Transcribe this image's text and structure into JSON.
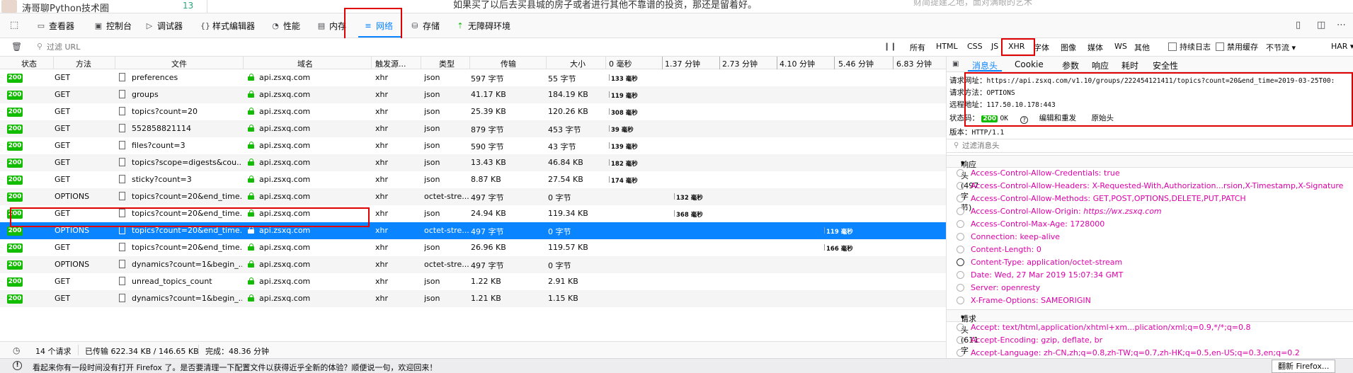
{
  "page_strip": {
    "author": "涛哥聊Python技术圈",
    "count": "13",
    "article_text": "如果买了以后去买县城的房子或者进行其他不靠谱的投资，那还是留着好。",
    "side_text": "财简提建之地，面对满眼的艺术"
  },
  "devtools_tabs": [
    {
      "label": "查看器",
      "icon": "inspector-icon"
    },
    {
      "label": "控制台",
      "icon": "console-icon"
    },
    {
      "label": "调试器",
      "icon": "debugger-icon"
    },
    {
      "label": "样式编辑器",
      "icon": "style-editor-icon"
    },
    {
      "label": "性能",
      "icon": "performance-icon"
    },
    {
      "label": "内存",
      "icon": "memory-icon"
    },
    {
      "label": "网络",
      "icon": "network-icon"
    },
    {
      "label": "存储",
      "icon": "storage-icon"
    },
    {
      "label": "无障碍环境",
      "icon": "accessibility-icon"
    }
  ],
  "selected_tab": "网络",
  "filter": {
    "placeholder": "过滤 URL",
    "types": [
      "所有",
      "HTML",
      "CSS",
      "JS",
      "XHR",
      "字体",
      "图像",
      "媒体",
      "WS",
      "其他"
    ],
    "active_type": "XHR",
    "persist_logs": "持续日志",
    "disable_cache": "禁用缓存",
    "throttle": "不节流 ▾",
    "har": "HAR ▾"
  },
  "columns": [
    "状态",
    "方法",
    "文件",
    "域名",
    "触发源...",
    "类型",
    "传输",
    "大小"
  ],
  "waterfall_ticks": [
    "0 毫秒",
    "1.37 分钟",
    "2.73 分钟",
    "4.10 分钟",
    "5.46 分钟",
    "6.83 分钟"
  ],
  "requests": [
    {
      "status": "200",
      "method": "GET",
      "file": "preferences",
      "domain": "api.zsxq.com",
      "cause": "xhr",
      "type": "json",
      "transferred": "597 字节",
      "size": "55 字节",
      "timing": "133 毫秒",
      "wf_pos": 0
    },
    {
      "status": "200",
      "method": "GET",
      "file": "groups",
      "domain": "api.zsxq.com",
      "cause": "xhr",
      "type": "json",
      "transferred": "41.17 KB",
      "size": "184.19 KB",
      "timing": "119 毫秒",
      "wf_pos": 0
    },
    {
      "status": "200",
      "method": "GET",
      "file": "topics?count=20",
      "domain": "api.zsxq.com",
      "cause": "xhr",
      "type": "json",
      "transferred": "25.39 KB",
      "size": "120.26 KB",
      "timing": "308 毫秒",
      "wf_pos": 0
    },
    {
      "status": "200",
      "method": "GET",
      "file": "552858821114",
      "domain": "api.zsxq.com",
      "cause": "xhr",
      "type": "json",
      "transferred": "879 字节",
      "size": "453 字节",
      "timing": "39 毫秒",
      "wf_pos": 0
    },
    {
      "status": "200",
      "method": "GET",
      "file": "files?count=3",
      "domain": "api.zsxq.com",
      "cause": "xhr",
      "type": "json",
      "transferred": "590 字节",
      "size": "43 字节",
      "timing": "139 毫秒",
      "wf_pos": 0
    },
    {
      "status": "200",
      "method": "GET",
      "file": "topics?scope=digests&cou...",
      "domain": "api.zsxq.com",
      "cause": "xhr",
      "type": "json",
      "transferred": "13.43 KB",
      "size": "46.84 KB",
      "timing": "182 毫秒",
      "wf_pos": 0
    },
    {
      "status": "200",
      "method": "GET",
      "file": "sticky?count=3",
      "domain": "api.zsxq.com",
      "cause": "xhr",
      "type": "json",
      "transferred": "8.87 KB",
      "size": "27.54 KB",
      "timing": "174 毫秒",
      "wf_pos": 0
    },
    {
      "status": "200",
      "method": "OPTIONS",
      "file": "topics?count=20&end_time...",
      "domain": "api.zsxq.com",
      "cause": "xhr",
      "type": "octet-stre...",
      "transferred": "497 字节",
      "size": "0 字节",
      "timing": "132 毫秒",
      "wf_pos": 0.2
    },
    {
      "status": "200",
      "method": "GET",
      "file": "topics?count=20&end_time...",
      "domain": "api.zsxq.com",
      "cause": "xhr",
      "type": "json",
      "transferred": "24.94 KB",
      "size": "119.34 KB",
      "timing": "368 毫秒",
      "wf_pos": 0.2
    },
    {
      "status": "200",
      "method": "OPTIONS",
      "file": "topics?count=20&end_time...",
      "domain": "api.zsxq.com",
      "cause": "xhr",
      "type": "octet-stre...",
      "transferred": "497 字节",
      "size": "0 字节",
      "timing": "119 毫秒",
      "wf_pos": 0.66,
      "selected": true
    },
    {
      "status": "200",
      "method": "GET",
      "file": "topics?count=20&end_time...",
      "domain": "api.zsxq.com",
      "cause": "xhr",
      "type": "json",
      "transferred": "26.96 KB",
      "size": "119.57 KB",
      "timing": "166 毫秒",
      "wf_pos": 0.66
    },
    {
      "status": "200",
      "method": "OPTIONS",
      "file": "dynamics?count=1&begin_...",
      "domain": "api.zsxq.com",
      "cause": "xhr",
      "type": "octet-stre...",
      "transferred": "497 字节",
      "size": "0 字节",
      "timing": "",
      "wf_pos": 0
    },
    {
      "status": "200",
      "method": "GET",
      "file": "unread_topics_count",
      "domain": "api.zsxq.com",
      "cause": "xhr",
      "type": "json",
      "transferred": "1.22 KB",
      "size": "2.91 KB",
      "timing": "",
      "wf_pos": 0
    },
    {
      "status": "200",
      "method": "GET",
      "file": "dynamics?count=1&begin_...",
      "domain": "api.zsxq.com",
      "cause": "xhr",
      "type": "json",
      "transferred": "1.21 KB",
      "size": "1.15 KB",
      "timing": "",
      "wf_pos": 0
    }
  ],
  "summary": {
    "requests": "14 个请求",
    "transferred": "已传输 622.34 KB / 146.65 KB",
    "finish": "完成：48.36 分钟"
  },
  "details": {
    "tabs": [
      "消息头",
      "Cookie",
      "参数",
      "响应",
      "耗时",
      "安全性"
    ],
    "selected_tab": "消息头",
    "request_url_label": "请求网址：",
    "request_url": "https://api.zsxq.com/v1.10/groups/222454121411/topics?count=20&end_time=2019-03-25T00:",
    "request_method_label": "请求方法：",
    "request_method": "OPTIONS",
    "remote_address_label": "远程地址：",
    "remote_address": "117.50.10.178:443",
    "status_code_label": "状态码：",
    "status_code": "200",
    "status_text": "OK",
    "edit_resend": "编辑和重发",
    "raw_headers": "原始头",
    "version_label": "版本：",
    "version": "HTTP/1.1",
    "filter_placeholder": "过滤消息头",
    "response_headers_title": "响应头 (497 字节)",
    "response_headers": [
      {
        "name": "Access-Control-Allow-Credentials:",
        "value": "true"
      },
      {
        "name": "Access-Control-Allow-Headers:",
        "value": "X-Requested-With,Authorization...rsion,X-Timestamp,X-Signature"
      },
      {
        "name": "Access-Control-Allow-Methods:",
        "value": "GET,POST,OPTIONS,DELETE,PUT,PATCH"
      },
      {
        "name": "Access-Control-Allow-Origin:",
        "value": "https://wx.zsxq.com"
      },
      {
        "name": "Access-Control-Max-Age:",
        "value": "1728000"
      },
      {
        "name": "Connection:",
        "value": "keep-alive"
      },
      {
        "name": "Content-Length:",
        "value": "0"
      },
      {
        "name": "Content-Type:",
        "value": "application/octet-stream"
      },
      {
        "name": "Date:",
        "value": "Wed, 27 Mar 2019 15:07:34 GMT"
      },
      {
        "name": "Server:",
        "value": "openresty"
      },
      {
        "name": "X-Frame-Options:",
        "value": "SAMEORIGIN"
      }
    ],
    "request_headers_title": "请求头 (611 字节)",
    "request_headers": [
      {
        "name": "Accept:",
        "value": "text/html,application/xhtml+xm...plication/xml;q=0.9,*/*;q=0.8"
      },
      {
        "name": "Accept-Encoding:",
        "value": "gzip, deflate, br"
      },
      {
        "name": "Accept-Language:",
        "value": "zh-CN,zh;q=0.8,zh-TW;q=0.7,zh-HK;q=0.5,en-US;q=0.3,en;q=0.2"
      }
    ]
  },
  "notification": {
    "message": "看起来你有一段时间没有打开 Firefox 了。是否要清理一下配置文件以获得近乎全新的体验？顺便说一句，欢迎回来！",
    "button": "翻新 Firefox..."
  },
  "colors": {
    "accent": "#0a84ff",
    "status_ok": "#12bc00",
    "header_name": "#dd00a9",
    "annotation": "#e00000"
  }
}
